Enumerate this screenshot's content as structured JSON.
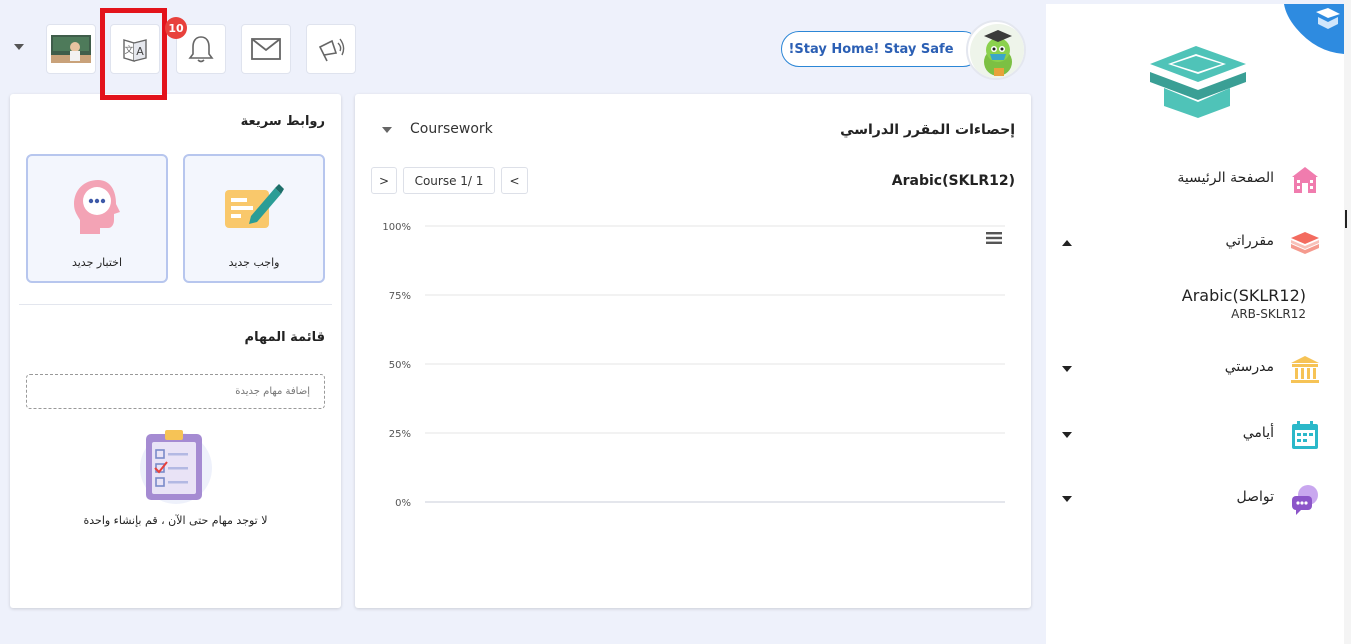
{
  "topbar": {
    "notification_count": "10",
    "stay_home_label": "!Stay Home! Stay Safe"
  },
  "quick_links": {
    "title": "روابط سريعة",
    "new_assignment": "واجب جديد",
    "new_quiz": "اختبار جديد"
  },
  "tasks": {
    "title": "قائمة المهام",
    "input_placeholder": "إضافة مهام جديدة",
    "empty_text": "لا توجد مهام حتى الآن ، قم بإنشاء واحدة"
  },
  "stats": {
    "title": "إحصاءات المقرر الدراسي",
    "filter_value": "Coursework",
    "course_name": "Arabic(SKLR12)",
    "pager": "Course 1/ 1",
    "prev": "<",
    "next": ">"
  },
  "chart_data": {
    "type": "bar",
    "title": "",
    "categories": [],
    "values": [],
    "ylim": [
      0,
      100
    ],
    "ytick_labels": [
      "0%",
      "25%",
      "50%",
      "75%",
      "100%"
    ],
    "grid": true,
    "menu_icon": "hamburger-icon"
  },
  "sidebar": {
    "items": [
      {
        "label": "الصفحة الرئيسية",
        "icon": "school-icon",
        "color": "#f07cae"
      },
      {
        "label": "مقرراتي",
        "icon": "books-icon",
        "color": "#f36b5f",
        "expanded": true
      },
      {
        "label": "مدرستي",
        "icon": "institution-icon",
        "color": "#f6c356"
      },
      {
        "label": "أيامي",
        "icon": "calendar-icon",
        "color": "#2bb8c9"
      },
      {
        "label": "تواصل",
        "icon": "chat-icon",
        "color": "#8c55c9"
      }
    ],
    "course": {
      "name": "Arabic(SKLR12)",
      "code": "ARB-SKLR12"
    }
  },
  "colors": {
    "accent": "#2b86d6",
    "badge": "#e8413c",
    "highlight": "#e3131b"
  }
}
